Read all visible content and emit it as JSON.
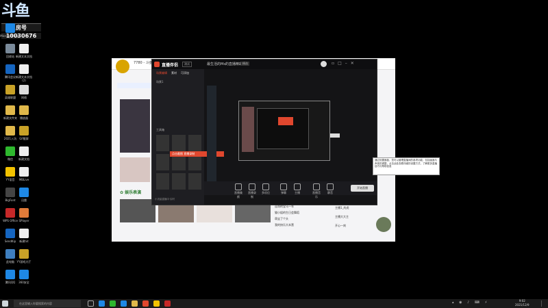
{
  "watermark": {
    "logo": "斗鱼",
    "room_label": "房号",
    "room_number": "10030676"
  },
  "desktop": {
    "icons": [
      {
        "label": "Microsoft Edge",
        "color": "#1e88e5"
      },
      {
        "label": "回收站",
        "color": "#7a8a9a"
      },
      {
        "label": "腾讯会议",
        "color": "#1565c0"
      },
      {
        "label": "英雄联盟",
        "color": "#c9a227"
      },
      {
        "label": "新建文件夹",
        "color": "#e0b84a"
      },
      {
        "label": "2021入坑",
        "color": "#e0b84a"
      },
      {
        "label": "微信",
        "color": "#2eb82e"
      },
      {
        "label": "YY语音",
        "color": "#f2c200"
      },
      {
        "label": "BigFont",
        "color": "#444"
      },
      {
        "label": "WPS Office",
        "color": "#c62828"
      },
      {
        "label": "SendKip",
        "color": "#1565c0"
      },
      {
        "label": "此电脑",
        "color": "#3f7fbf"
      },
      {
        "label": "腾讯QQ",
        "color": "#1e88e5"
      }
    ],
    "icons2": [
      {
        "label": "新建文本文档",
        "color": "#eee"
      },
      {
        "label": "新建文本文档 (2)",
        "color": "#eee"
      },
      {
        "label": "网络",
        "color": "#ddd"
      },
      {
        "label": "播放器",
        "color": "#e0b84a"
      },
      {
        "label": "Gif截屏",
        "color": "#c9a227"
      },
      {
        "label": "新建文档",
        "color": "#eee"
      },
      {
        "label": "MBLive",
        "color": "#eee"
      },
      {
        "label": "迅雷",
        "color": "#1e88e5"
      },
      {
        "label": "SPlayer",
        "color": "#e07b39"
      },
      {
        "label": "新建txt",
        "color": "#eee"
      },
      {
        "label": "YY游戏大厅",
        "color": "#c9a227"
      },
      {
        "label": "360安全",
        "color": "#1e88e5"
      }
    ]
  },
  "app": {
    "title": "直播伴侣",
    "version": "测试",
    "header_text": "最生活的Ms的直播精彩",
    "header_badge": "精选",
    "tabs": [
      "场景编辑",
      "素材",
      "可添加"
    ],
    "scene_label": "场景1",
    "toolbox_label": "工具箱",
    "highlight_text": "点击截图 直播录制",
    "bottom_buttons": [
      "直播美颜",
      "直播录制",
      "多机位",
      "弹幕",
      "主播",
      "直播音乐",
      "静音"
    ],
    "start_button": "开始直播",
    "footer": "小流量直播中·实时"
  },
  "browser": {
    "tab_text": "7780 - 斗鱼直播",
    "section": "娱乐表演",
    "list_items": [
      "逗哥的宝马一车",
      "猫小姐的生日会舞蹈",
      "萌宝了个头",
      "我的快乐大本营"
    ],
    "right_items": [
      "主播1_的虎",
      "主播大大主",
      "开心一刻"
    ]
  },
  "tooltip": {
    "text": "通过设置面板，您可以管理直播间的各项功能，包括画面与声音的调整，点击此处查看详细的设置方式，了解更多直播技巧与帮助信息"
  },
  "taskbar": {
    "search_placeholder": "在这里输入你要搜索的内容",
    "time": "9:02",
    "date": "2021/12/9"
  },
  "colors": {
    "accent": "#e0472e",
    "obs_bg": "#141416",
    "taskbar": "#1b1b1b"
  }
}
